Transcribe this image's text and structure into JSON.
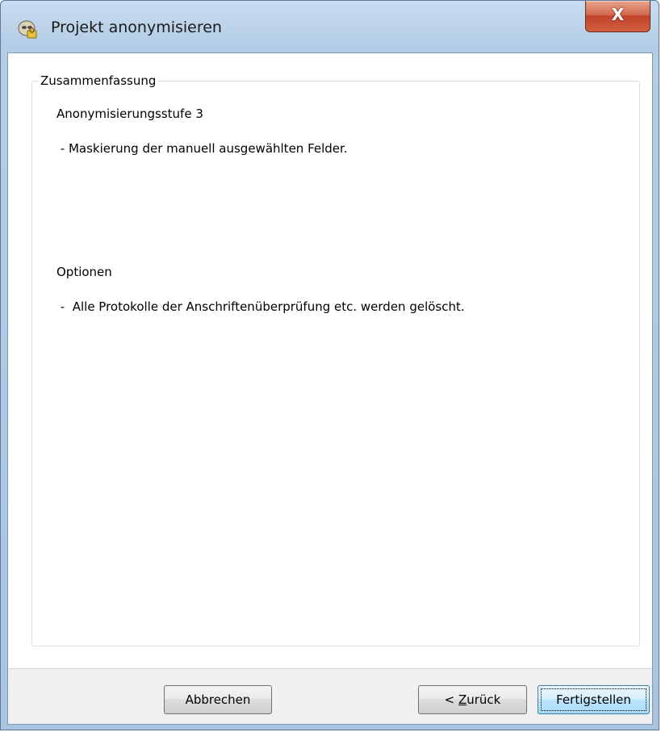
{
  "window": {
    "title": "Projekt anonymisieren",
    "close_glyph": "X",
    "icon": "project-anonymize-icon"
  },
  "summary": {
    "group_label": "Zusammenfassung",
    "level_heading": "Anonymisierungsstufe 3",
    "level_detail": " - Maskierung der manuell ausgewählten Felder.",
    "options_heading": "Optionen",
    "options_detail": " -  Alle Protokolle der Anschriftenüberprüfung etc. werden gelöscht."
  },
  "footer": {
    "cancel_label": "Abbrechen",
    "back_prefix": "< ",
    "back_mnemonic": "Z",
    "back_rest": "urück",
    "finish_label": "Fertigstellen"
  },
  "colors": {
    "titlebar": "#b4cde6",
    "close_button": "#c2432a",
    "default_button_border": "#3c7fb1",
    "footer_bg": "#f0f0f0"
  }
}
